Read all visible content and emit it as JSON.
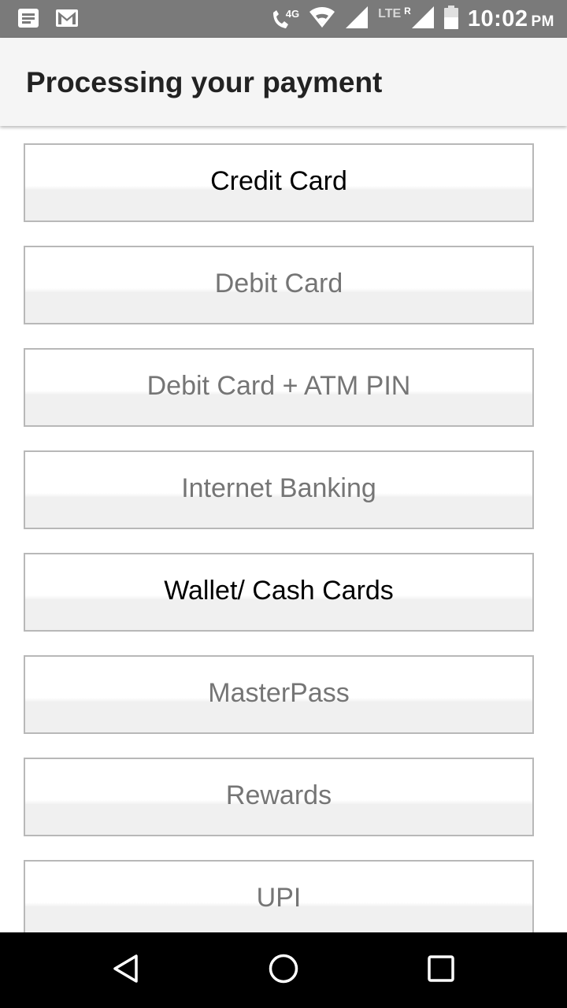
{
  "status_bar": {
    "network_label": "4G",
    "lte_label": "LTE",
    "roaming_label": "R",
    "time": "10:02",
    "ampm": "PM",
    "icons": [
      "notes-icon",
      "gmail-icon",
      "volte-call-icon",
      "wifi-icon",
      "signal-icon",
      "signal-roaming-icon",
      "battery-icon"
    ]
  },
  "app_bar": {
    "title": "Processing your payment"
  },
  "options": [
    {
      "label": "Credit Card",
      "active": true
    },
    {
      "label": "Debit Card",
      "active": false
    },
    {
      "label": "Debit Card + ATM PIN",
      "active": false
    },
    {
      "label": "Internet Banking",
      "active": false
    },
    {
      "label": "Wallet/ Cash Cards",
      "active": true
    },
    {
      "label": "MasterPass",
      "active": false
    },
    {
      "label": "Rewards",
      "active": false
    },
    {
      "label": "UPI",
      "active": false
    }
  ],
  "nav_bar": {
    "icons": [
      "back-icon",
      "home-icon",
      "recents-icon"
    ]
  },
  "colors": {
    "status_bar": "#7a7a7a",
    "app_bar": "#f5f5f5",
    "option_active_text": "#000000",
    "option_inactive_text": "#757575",
    "nav_bar": "#000000"
  }
}
